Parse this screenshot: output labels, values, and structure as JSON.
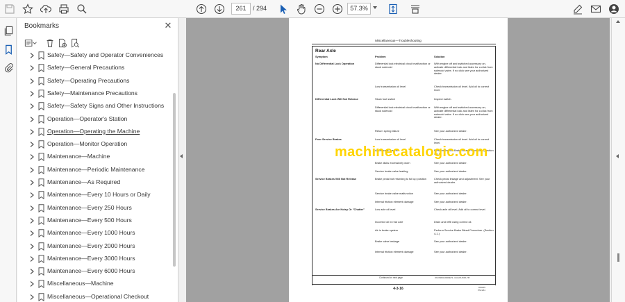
{
  "toolbar": {
    "page_current": "261",
    "page_total": "/  294",
    "zoom": "57.3%"
  },
  "bookmarks": {
    "title": "Bookmarks",
    "items": [
      {
        "label": "Safety—Safety and Operator Conveniences"
      },
      {
        "label": "Safety—General Precautions"
      },
      {
        "label": "Safety—Operating Precautions"
      },
      {
        "label": "Safety—Maintenance Precautions"
      },
      {
        "label": "Safety—Safety Signs and Other Instructions"
      },
      {
        "label": "Operation—Operator's Station"
      },
      {
        "label": "Operation—Operating the Machine"
      },
      {
        "label": "Operation—Monitor Operation"
      },
      {
        "label": "Maintenance—Machine"
      },
      {
        "label": "Maintenance—Periodic Maintenance"
      },
      {
        "label": "Maintenance—As Required"
      },
      {
        "label": "Maintenance—Every 10 Hours or Daily"
      },
      {
        "label": "Maintenance—Every 250 Hours"
      },
      {
        "label": "Maintenance—Every 500 Hours"
      },
      {
        "label": "Maintenance—Every 1000 Hours"
      },
      {
        "label": "Maintenance—Every 2000 Hours"
      },
      {
        "label": "Maintenance—Every 3000 Hours"
      },
      {
        "label": "Maintenance—Every 6000 Hours"
      },
      {
        "label": "Miscellaneous—Machine"
      },
      {
        "label": "Miscellaneous—Operational Checkout"
      }
    ]
  },
  "document": {
    "header": "Miscellaneous—Troubleshooting",
    "section": "Rear Axle",
    "col_symptom": "Symptom",
    "col_problem": "Problem",
    "col_solution": "Solution",
    "rows": [
      {
        "symptom": "No Differential Lock Operation",
        "problem": "Differential lock electrical circuit malfunction or stuck solenoid",
        "solution": "With engine off and switched accessory on, activate differential lock and listen for a click from solenoid valve.  If no click see your authorized dealer."
      },
      {
        "symptom": "",
        "problem": "Low transmission oil level",
        "solution": "Check transmission oil level. Add oil to correct level."
      },
      {
        "symptom": "Differential Lock Will Not Release",
        "problem": "Stuck foot switch",
        "solution": "Inspect switch."
      },
      {
        "symptom": "",
        "problem": "Differential lock electrical circuit malfunction or stuck solenoid",
        "solution": "With engine off and switched accessory on, activate differential lock and listen for a click from solenoid valve.  If no click see your authorized dealer."
      },
      {
        "symptom": "",
        "problem": "Return spring failure",
        "solution": "See your authorized dealer."
      },
      {
        "symptom": "Poor Service Brakes",
        "problem": "Low transmission oil level",
        "solution": "Check transmission oil level. Add oil to correct level."
      },
      {
        "symptom": "",
        "problem": "Air in brake system",
        "solution": "Perform Service Brake Bleed Procedure. (Section 4-1.)"
      },
      {
        "symptom": "",
        "problem": "Brake disks excessively worn",
        "solution": "See your authorized dealer."
      },
      {
        "symptom": "",
        "problem": "Service brake valve leaking",
        "solution": "See your authorized dealer."
      },
      {
        "symptom": "Service Brakes Will Not Release",
        "problem": "Brake pedal not returning to full up position",
        "solution": "Check pedal linkage and adjustment. See your authorized dealer."
      },
      {
        "symptom": "",
        "problem": "Service brake valve malfunction",
        "solution": "See your authorized dealer."
      },
      {
        "symptom": "",
        "problem": "Internal friction element damage",
        "solution": "See your authorized dealer."
      },
      {
        "symptom": "Service Brakes Are Noisy Or \"Chatter\"",
        "problem": "Low axle oil level",
        "solution": "Check axle oil level.  Add oil to correct level."
      },
      {
        "symptom": "",
        "problem": "Incorrect oil in rear axle",
        "solution": "Drain and refill using correct oil."
      },
      {
        "symptom": "",
        "problem": "Air in brake system",
        "solution": "Perform Service Brake Bleed Procedure. (Section 4-1.)"
      },
      {
        "symptom": "",
        "problem": "Brake valve leakage",
        "solution": "See your authorized dealer."
      },
      {
        "symptom": "",
        "problem": "Internal friction element damage",
        "solution": "See your authorized dealer."
      }
    ],
    "footer_note": "Continued on next page",
    "footer_ref": "OUO6093,0000E72 -19-02JUN15-7/8",
    "page_number": "4-3-16",
    "page_code": "061215\nPN=261"
  },
  "watermark": "machinecatalogic.com"
}
